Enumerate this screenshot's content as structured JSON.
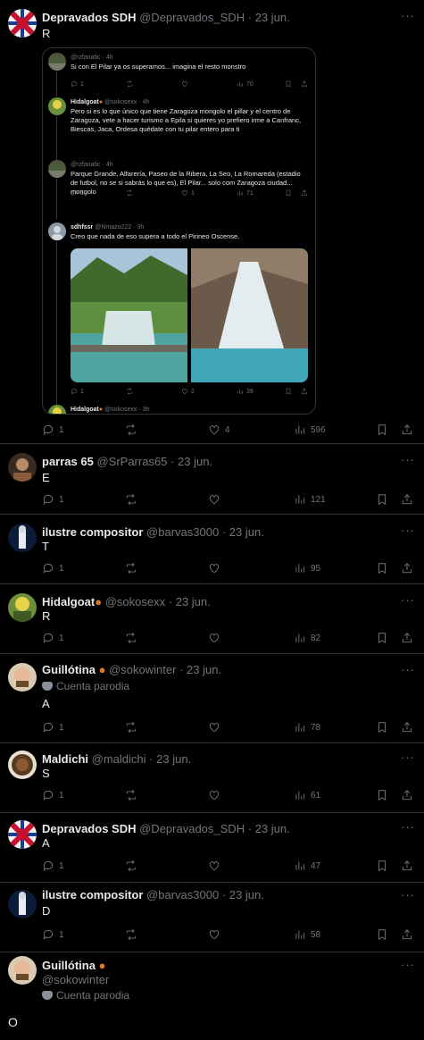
{
  "tweets": [
    {
      "name": "Depravados SDH",
      "handle": "@Depravados_SDH",
      "date": "23 jun.",
      "text": "R",
      "replies": "1",
      "retweets": "",
      "likes": "4",
      "views": "596",
      "quoted": [
        {
          "name": "",
          "handle": "@rzfanatic",
          "time": "4h",
          "text": "Si con El Pilar ya os superamos... imagina el resto monstro",
          "replies": "1",
          "retweets": "",
          "likes": "",
          "views": "70"
        },
        {
          "name": "Hidalgoat",
          "handle": "@sokosexx",
          "time": "4h",
          "text": "Pero si es lo que único que tiene Zaragoza mongolo el pillar y el centro de Zaragoza, vete a hacer turismo a Epila si quieres yo prefiero irme a Canfranc, Biescas, Jaca, Ordesa quédate con tu pilar entero para ti",
          "replies": "1",
          "retweets": "",
          "likes": "1",
          "views": "71"
        },
        {
          "name": "",
          "handle": "@rzfanatic",
          "time": "4h",
          "text": "Parque Grande, Alfarería, Paseo de la Ribera, La Seo, La Romareda (estadio de futbol, no se si sabrás lo que es), El Pilar... solo com Zaragoza ciudad... mongolo",
          "replies": "4",
          "retweets": "",
          "likes": "",
          "views": "72"
        },
        {
          "name": "sdhfssr",
          "handle": "@Nmazo222",
          "time": "3h",
          "text": "Creo que nada de eso supera a todo el Pirineo Oscense.",
          "replies": "1",
          "retweets": "",
          "likes": "2",
          "views": "39"
        },
        {
          "name": "Hidalgoat",
          "handle": "@sokosexx",
          "time": "3h",
          "text": ""
        }
      ]
    },
    {
      "name": "parras 65",
      "handle": "@SrParras65",
      "date": "23 jun.",
      "text": "E",
      "replies": "1",
      "likes": "",
      "views": "121"
    },
    {
      "name": "ilustre compositor",
      "handle": "@barvas3000",
      "date": "23 jun.",
      "text": "T",
      "replies": "1",
      "likes": "",
      "views": "95"
    },
    {
      "name": "Hidalgoat",
      "handle": "@sokosexx",
      "date": "23 jun.",
      "text": "R",
      "replies": "1",
      "likes": "",
      "views": "82"
    },
    {
      "name": "Guillótina",
      "handle": "@sokowinter",
      "date": "23 jun.",
      "parody": "Cuenta parodia",
      "text": "A",
      "replies": "1",
      "likes": "",
      "views": "78"
    },
    {
      "name": "Maldichi",
      "handle": "@maldichi",
      "date": "23 jun.",
      "text": "S",
      "replies": "1",
      "likes": "",
      "views": "61"
    },
    {
      "name": "Depravados SDH",
      "handle": "@Depravados_SDH",
      "date": "23 jun.",
      "text": "A",
      "replies": "1",
      "likes": "",
      "views": "47"
    },
    {
      "name": "ilustre compositor",
      "handle": "@barvas3000",
      "date": "23 jun.",
      "text": "D",
      "replies": "1",
      "likes": "",
      "views": "58"
    },
    {
      "name": "Guillótina",
      "handle": "@sokowinter",
      "parody": "Cuenta parodia",
      "text": "O"
    }
  ],
  "dot": "·",
  "more": "···",
  "icons": [
    "reply-icon",
    "retweet-icon",
    "like-icon",
    "views-icon",
    "bookmark-icon",
    "share-icon"
  ],
  "colors": {
    "background": "#000000",
    "text": "#e7e9ea",
    "muted": "#71767b",
    "border": "#2f3336"
  }
}
